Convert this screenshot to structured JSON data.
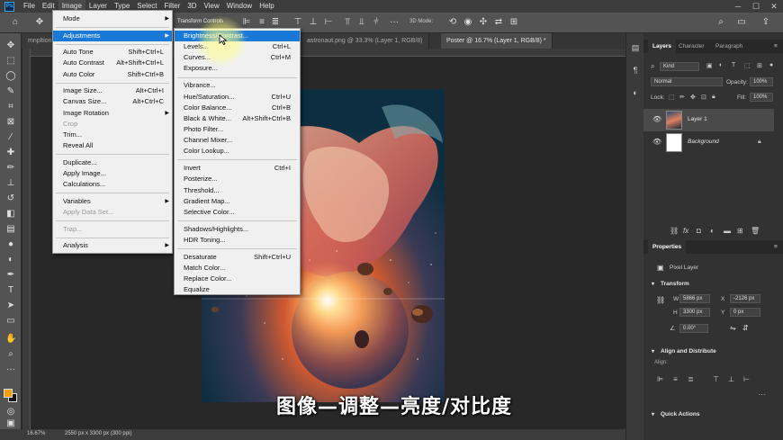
{
  "app": {
    "logo": "Ps",
    "menubar": [
      "File",
      "Edit",
      "Image",
      "Layer",
      "Type",
      "Select",
      "Filter",
      "3D",
      "View",
      "Window",
      "Help"
    ],
    "active_menu": "Image"
  },
  "options_bar": {
    "transform_controls": "Transform Controls",
    "mode_3d": "3D Mode:"
  },
  "tabs": [
    {
      "label": "mnpltion",
      "active": false
    },
    {
      "label": "astronaut.png @ 33.3% (Layer 1, RGB/8)",
      "active": false
    },
    {
      "label": "Poster @ 16.7% (Layer 1, RGB/8) *",
      "active": true
    }
  ],
  "status": {
    "zoom": "16.67%",
    "doc_info": "2550 px x 3300 px (300 ppi)"
  },
  "subtitle": "图像—调整—亮度/对比度",
  "image_menu": [
    {
      "label": "Mode",
      "shortcut": "",
      "arrow": true
    },
    {
      "sep": true
    },
    {
      "label": "Adjustments",
      "shortcut": "",
      "arrow": true,
      "highlight": true
    },
    {
      "sep": true
    },
    {
      "label": "Auto Tone",
      "shortcut": "Shift+Ctrl+L"
    },
    {
      "label": "Auto Contrast",
      "shortcut": "Alt+Shift+Ctrl+L"
    },
    {
      "label": "Auto Color",
      "shortcut": "Shift+Ctrl+B"
    },
    {
      "sep": true
    },
    {
      "label": "Image Size...",
      "shortcut": "Alt+Ctrl+I"
    },
    {
      "label": "Canvas Size...",
      "shortcut": "Alt+Ctrl+C"
    },
    {
      "label": "Image Rotation",
      "shortcut": "",
      "arrow": true
    },
    {
      "label": "Crop",
      "shortcut": "",
      "disabled": true
    },
    {
      "label": "Trim...",
      "shortcut": ""
    },
    {
      "label": "Reveal All",
      "shortcut": ""
    },
    {
      "sep": true
    },
    {
      "label": "Duplicate...",
      "shortcut": ""
    },
    {
      "label": "Apply Image...",
      "shortcut": ""
    },
    {
      "label": "Calculations...",
      "shortcut": ""
    },
    {
      "sep": true
    },
    {
      "label": "Variables",
      "shortcut": "",
      "arrow": true
    },
    {
      "label": "Apply Data Set...",
      "shortcut": "",
      "disabled": true
    },
    {
      "sep": true
    },
    {
      "label": "Trap...",
      "shortcut": "",
      "disabled": true
    },
    {
      "sep": true
    },
    {
      "label": "Analysis",
      "shortcut": "",
      "arrow": true
    }
  ],
  "adjustments_menu": [
    {
      "label": "Brightness/Contrast...",
      "shortcut": "",
      "highlight": true
    },
    {
      "label": "Levels...",
      "shortcut": "Ctrl+L"
    },
    {
      "label": "Curves...",
      "shortcut": "Ctrl+M"
    },
    {
      "label": "Exposure...",
      "shortcut": ""
    },
    {
      "sep": true
    },
    {
      "label": "Vibrance...",
      "shortcut": ""
    },
    {
      "label": "Hue/Saturation...",
      "shortcut": "Ctrl+U"
    },
    {
      "label": "Color Balance...",
      "shortcut": "Ctrl+B"
    },
    {
      "label": "Black & White...",
      "shortcut": "Alt+Shift+Ctrl+B"
    },
    {
      "label": "Photo Filter...",
      "shortcut": ""
    },
    {
      "label": "Channel Mixer...",
      "shortcut": ""
    },
    {
      "label": "Color Lookup...",
      "shortcut": ""
    },
    {
      "sep": true
    },
    {
      "label": "Invert",
      "shortcut": "Ctrl+I"
    },
    {
      "label": "Posterize...",
      "shortcut": ""
    },
    {
      "label": "Threshold...",
      "shortcut": ""
    },
    {
      "label": "Gradient Map...",
      "shortcut": ""
    },
    {
      "label": "Selective Color...",
      "shortcut": ""
    },
    {
      "sep": true
    },
    {
      "label": "Shadows/Highlights...",
      "shortcut": ""
    },
    {
      "label": "HDR Toning...",
      "shortcut": ""
    },
    {
      "sep": true
    },
    {
      "label": "Desaturate",
      "shortcut": "Shift+Ctrl+U"
    },
    {
      "label": "Match Color...",
      "shortcut": ""
    },
    {
      "label": "Replace Color...",
      "shortcut": ""
    },
    {
      "label": "Equalize",
      "shortcut": ""
    }
  ],
  "layers_panel": {
    "tabs": [
      "Layers",
      "Character",
      "Paragraph"
    ],
    "filter_kind": "Kind",
    "blend_mode": "Normal",
    "opacity_label": "Opacity:",
    "opacity": "100%",
    "lock_label": "Lock:",
    "fill_label": "Fill:",
    "fill": "100%",
    "layers": [
      {
        "name": "Layer 1",
        "selected": true,
        "italic": false
      },
      {
        "name": "Background",
        "selected": false,
        "italic": true
      }
    ]
  },
  "properties_panel": {
    "title": "Properties",
    "layer_type": "Pixel Layer",
    "transform_title": "Transform",
    "w_label": "W",
    "w": "5866 px",
    "x": "-2126 px",
    "h_label": "H",
    "h": "3300 px",
    "y": "0 px",
    "angle": "0.00°",
    "align_title": "Align and Distribute",
    "align_label": "Align:",
    "quick_actions": "Quick Actions"
  },
  "colors": {
    "accent": "#1a78d6",
    "foreground_swatch": "#f5a000",
    "background_swatch": "#111111"
  }
}
